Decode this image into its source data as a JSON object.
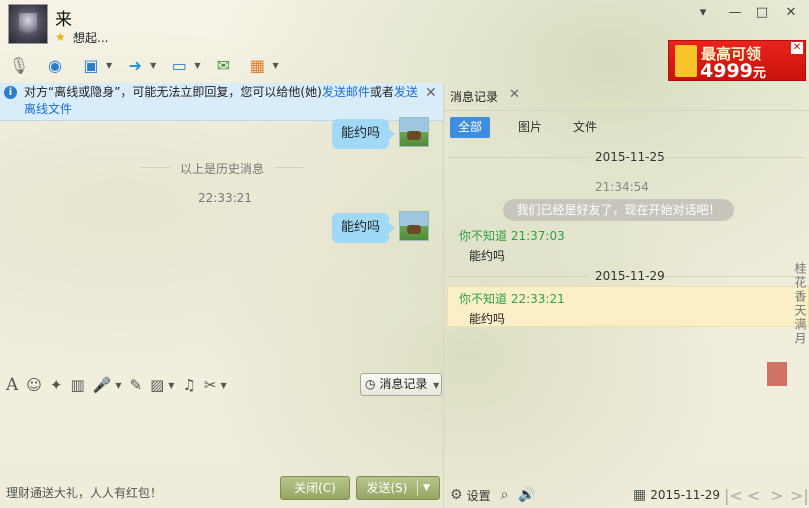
{
  "window": {
    "minimize": "▾",
    "min2": "—",
    "maximize": "□",
    "close": "✕"
  },
  "header": {
    "name": "来",
    "signature": "想起..."
  },
  "ad": {
    "line1": "最高可领",
    "amount": "4999",
    "unit": "元"
  },
  "notice": {
    "prefix": "对方“离线或隐身”，可能无法立即回复，您可以给他(她)",
    "link1": "发送邮件",
    "middle": "或者",
    "link2": "发送离线文件"
  },
  "chat": {
    "bubble_text": "能约吗",
    "history_label": "以上是历史消息",
    "time": "22:33:21"
  },
  "input_toolbar": {
    "record_button": "消息记录"
  },
  "footer": {
    "promo": "理财通送大礼，人人有红包！",
    "close_btn": "关闭(C)",
    "send_btn": "发送(S)"
  },
  "history_panel": {
    "tab": "消息记录",
    "filters": [
      "全部",
      "图片",
      "文件"
    ],
    "date1": "2015-11-25",
    "time1": "21:34:54",
    "system_msg": "我们已经是好友了，现在开始对话吧！",
    "sender1": "你不知道 21:37:03",
    "msg1": "能约吗",
    "date2": "2015-11-29",
    "sender2": "你不知道 22:33:21",
    "msg2": "能约吗",
    "settings": "设置",
    "footer_date": "2015-11-29"
  },
  "decor": {
    "poem": "桂花香天满月"
  }
}
